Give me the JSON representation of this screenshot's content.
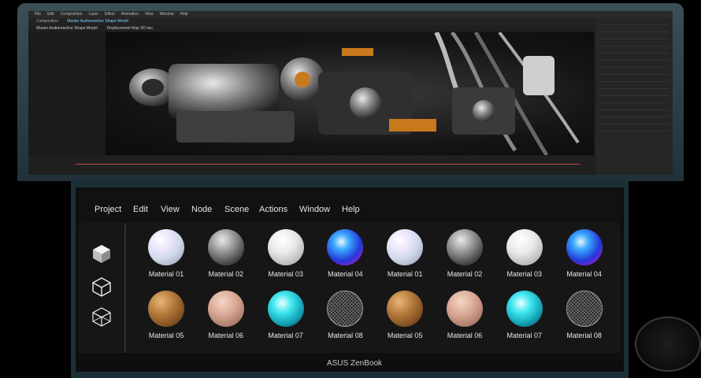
{
  "laptop_screen": {
    "menubar": [
      "File",
      "Edit",
      "Composition",
      "Layer",
      "Effect",
      "Animation",
      "View",
      "Window",
      "Help"
    ],
    "tabs": [
      "Composition",
      "Master Audioreactive Shape Morph"
    ],
    "subtabs": [
      "Master Audioreactive Shape Morph",
      "Displacement Map 3D sec."
    ]
  },
  "screenpad": {
    "menu": [
      "Project",
      "Edit",
      "View",
      "Node",
      "Scene",
      "Actions",
      "Window",
      "Help"
    ],
    "tools": [
      {
        "icon": "solid-cube-icon"
      },
      {
        "icon": "cube-outline-icon"
      },
      {
        "icon": "wireframe-cube-icon"
      }
    ],
    "materials_row1": [
      {
        "label": "Material 01",
        "style": "pearl"
      },
      {
        "label": "Material 02",
        "style": "chrome-dark"
      },
      {
        "label": "Material 03",
        "style": "white-gloss"
      },
      {
        "label": "Material 04",
        "style": "blue-glass"
      },
      {
        "label": "Material 01",
        "style": "pearl"
      },
      {
        "label": "Material 02",
        "style": "chrome-dark"
      },
      {
        "label": "Material 03",
        "style": "white-gloss"
      },
      {
        "label": "Material 04",
        "style": "blue-glass"
      }
    ],
    "materials_row2": [
      {
        "label": "Material 05",
        "style": "wood"
      },
      {
        "label": "Material 06",
        "style": "peach"
      },
      {
        "label": "Material 07",
        "style": "teal-glow"
      },
      {
        "label": "Material 08",
        "style": "mesh"
      },
      {
        "label": "Material 05",
        "style": "wood"
      },
      {
        "label": "Material 06",
        "style": "peach"
      },
      {
        "label": "Material 07",
        "style": "teal-glow"
      },
      {
        "label": "Material 08",
        "style": "mesh"
      }
    ]
  },
  "brand": "ASUS ZenBook"
}
